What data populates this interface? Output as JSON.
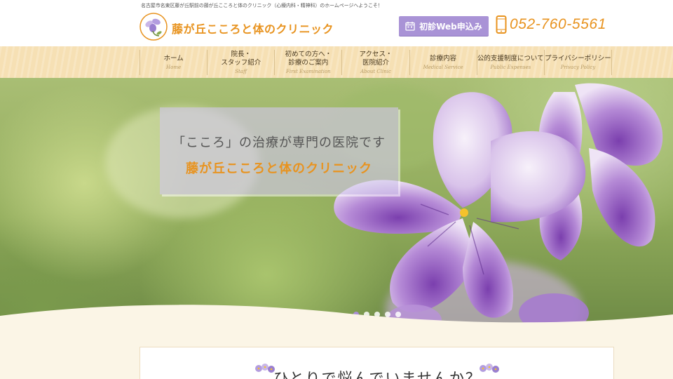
{
  "header": {
    "tagline": "名古屋市名東区藤が丘駅前の藤が丘こころと体のクリニック（心療内科・精神科）のホームページへようこそ！",
    "logo_text": "藤が丘こころと体のクリニック",
    "web_button": "初診Web申込み",
    "phone": "052-760-5561"
  },
  "nav": {
    "items": [
      {
        "jp": "ホーム",
        "en": "Home"
      },
      {
        "jp": "院長・\nスタッフ紹介",
        "en": "Staff"
      },
      {
        "jp": "初めての方へ・\n診療のご案内",
        "en": "First Examination"
      },
      {
        "jp": "アクセス・\n医院紹介",
        "en": "About Clinic"
      },
      {
        "jp": "診療内容",
        "en": "Medical Service"
      },
      {
        "jp": "公的支援制度について",
        "en": "Public Expenses"
      },
      {
        "jp": "プライバシーポリシー",
        "en": "Privacy Policy"
      }
    ]
  },
  "hero": {
    "caption_line1": "「こころ」の治療が専門の医院です",
    "caption_line2": "藤が丘こころと体のクリニック",
    "slides": 5,
    "active_slide": 1
  },
  "content": {
    "lead": "ひとりで悩んでいませんか？"
  },
  "colors": {
    "accent_orange": "#e8931f",
    "accent_purple": "#a993d6",
    "nav_bg": "#f6e0b4",
    "page_bg": "#fbf5e6"
  }
}
